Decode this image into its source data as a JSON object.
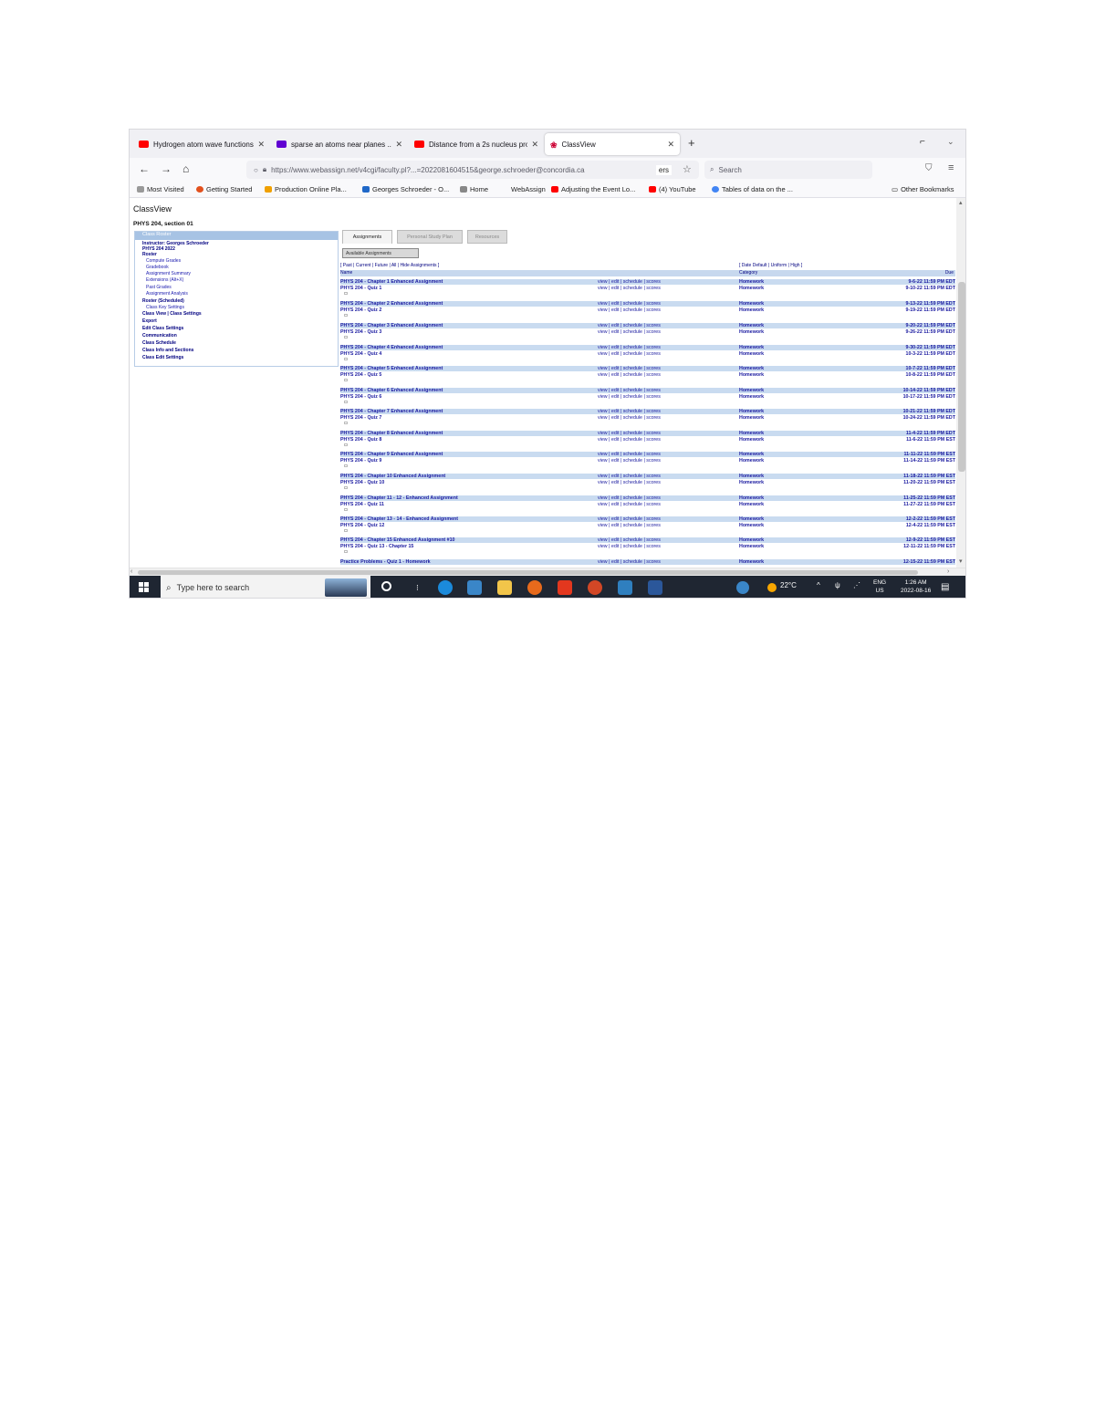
{
  "browser": {
    "tabs": [
      {
        "title": "Hydrogen atom wave functions",
        "favicon": "youtube"
      },
      {
        "title": "sparse an atoms near planes ... ",
        "favicon": "yahoo"
      },
      {
        "title": "Distance from a 2s nucleus pro",
        "favicon": "youtube"
      },
      {
        "title": "ClassView",
        "favicon": "classview"
      }
    ],
    "new_tab": "+",
    "url": "https://www.webassign.net/v4cgi/faculty.pl?...=2022081604515&george.schroeder@concordia.ca",
    "url_suffix": "ers",
    "search_placeholder": "Search",
    "bookmarks": [
      "Most Visited",
      "Getting Started",
      "Production Online Pla...",
      "Georges Schroeder - O...",
      "Home",
      "WebAssign",
      "Adjusting the Event Lo...",
      "(4) YouTube",
      "Tables of data on the ..."
    ],
    "other_bookmarks": "Other Bookmarks"
  },
  "page": {
    "title": "ClassView",
    "course": "PHYS 204, section 01",
    "left_nav": {
      "header": "Class Roster",
      "items": [
        "Instructor: Georges Schroeder",
        "PHYS 204 2022",
        "Roster",
        "Compute Grades",
        "Gradebook",
        "Assignment Summary",
        "Extensions (Alt+X)",
        "Past Grades",
        "Assignment Analysis",
        "Roster (Scheduled)",
        "Class Key Settings",
        "Class View | Class Settings",
        "Export",
        "Edit Class Settings",
        "Communication",
        "Class Schedule",
        "Class Info and Sections",
        "Class Edit Settings"
      ]
    },
    "tabs": [
      "Assignments",
      "Personal Study Plan",
      "Resources"
    ],
    "available_button": "Available Assignments",
    "filter_links": "[ Past | Current | Future | All | Hide Assignments ]",
    "filter_links_right": "[ Date Default | Uniform | High ]",
    "columns": {
      "name": "Name",
      "category": "Category",
      "due": "Due"
    },
    "assignments": [
      {
        "name": "PHYS 204 - Chapter 1 Enhanced Assignment",
        "links": "view | edit | schedule | scores",
        "category": "Homework",
        "due": "9-6-22 11:59 PM EDT"
      },
      {
        "name": "PHYS 204 - Quiz 1",
        "links": "view | edit | schedule | scores",
        "category": "Homework",
        "due": "9-10-22 11:59 PM EDT"
      },
      {
        "name": "PHYS 204 - Chapter 2 Enhanced Assignment",
        "links": "view | edit | schedule | scores",
        "category": "Homework",
        "due": "9-13-22 11:59 PM EDT"
      },
      {
        "name": "PHYS 204 - Quiz 2",
        "links": "view | edit | schedule | scores",
        "category": "Homework",
        "due": "9-19-22 11:59 PM EDT"
      },
      {
        "name": "PHYS 204 - Chapter 3 Enhanced Assignment",
        "links": "view | edit | schedule | scores",
        "category": "Homework",
        "due": "9-20-22 11:59 PM EDT"
      },
      {
        "name": "PHYS 204 - Quiz 3",
        "links": "view | edit | schedule | scores",
        "category": "Homework",
        "due": "9-26-22 11:59 PM EDT"
      },
      {
        "name": "PHYS 204 - Chapter 4 Enhanced Assignment",
        "links": "view | edit | schedule | scores",
        "category": "Homework",
        "due": "9-30-22 11:59 PM EDT"
      },
      {
        "name": "PHYS 204 - Quiz 4",
        "links": "view | edit | schedule | scores",
        "category": "Homework",
        "due": "10-3-22 11:59 PM EDT"
      },
      {
        "name": "PHYS 204 - Chapter 5 Enhanced Assignment",
        "links": "view | edit | schedule | scores",
        "category": "Homework",
        "due": "10-7-22 11:59 PM EDT"
      },
      {
        "name": "PHYS 204 - Quiz 5",
        "links": "view | edit | schedule | scores",
        "category": "Homework",
        "due": "10-8-22 11:59 PM EDT"
      },
      {
        "name": "PHYS 204 - Chapter 6 Enhanced Assignment",
        "links": "view | edit | schedule | scores",
        "category": "Homework",
        "due": "10-14-22 11:59 PM EDT"
      },
      {
        "name": "PHYS 204 - Quiz 6",
        "links": "view | edit | schedule | scores",
        "category": "Homework",
        "due": "10-17-22 11:59 PM EDT"
      },
      {
        "name": "PHYS 204 - Chapter 7 Enhanced Assignment",
        "links": "view | edit | schedule | scores",
        "category": "Homework",
        "due": "10-21-22 11:59 PM EDT"
      },
      {
        "name": "PHYS 204 - Quiz 7",
        "links": "view | edit | schedule | scores",
        "category": "Homework",
        "due": "10-24-22 11:59 PM EDT"
      },
      {
        "name": "PHYS 204 - Chapter 8 Enhanced Assignment",
        "links": "view | edit | schedule | scores",
        "category": "Homework",
        "due": "11-4-22 11:59 PM EDT"
      },
      {
        "name": "PHYS 204 - Quiz 8",
        "links": "view | edit | schedule | scores",
        "category": "Homework",
        "due": "11-6-22 11:59 PM EST"
      },
      {
        "name": "PHYS 204 - Chapter 9 Enhanced Assignment",
        "links": "view | edit | schedule | scores",
        "category": "Homework",
        "due": "11-11-22 11:59 PM EST"
      },
      {
        "name": "PHYS 204 - Quiz 9",
        "links": "view | edit | schedule | scores",
        "category": "Homework",
        "due": "11-14-22 11:59 PM EST"
      },
      {
        "name": "PHYS 204 - Chapter 10 Enhanced Assignment",
        "links": "view | edit | schedule | scores",
        "category": "Homework",
        "due": "11-18-22 11:59 PM EST"
      },
      {
        "name": "PHYS 204 - Quiz 10",
        "links": "view | edit | schedule | scores",
        "category": "Homework",
        "due": "11-20-22 11:59 PM EST"
      },
      {
        "name": "PHYS 204 - Chapter 11 - 12 - Enhanced Assignment",
        "links": "view | edit | schedule | scores",
        "category": "Homework",
        "due": "11-25-22 11:59 PM EST"
      },
      {
        "name": "PHYS 204 - Quiz 11",
        "links": "view | edit | schedule | scores",
        "category": "Homework",
        "due": "11-27-22 11:59 PM EST"
      },
      {
        "name": "PHYS 204 - Chapter 13 - 14 - Enhanced Assignment",
        "links": "view | edit | schedule | scores",
        "category": "Homework",
        "due": "12-2-22 11:59 PM EST"
      },
      {
        "name": "PHYS 204 - Quiz 12",
        "links": "view | edit | schedule | scores",
        "category": "Homework",
        "due": "12-4-22 11:59 PM EST"
      },
      {
        "name": "PHYS 204 - Chapter 15 Enhanced Assignment #10",
        "links": "view | edit | schedule | scores",
        "category": "Homework",
        "due": "12-9-22 11:59 PM EST"
      },
      {
        "name": "PHYS 204 - Quiz 13 - Chapter 15",
        "links": "view | edit | schedule | scores",
        "category": "Homework",
        "due": "12-11-22 11:59 PM EST"
      },
      {
        "name": "Practice Problems - Quiz 1 - Homework",
        "links": "view | edit | schedule | scores",
        "category": "Homework",
        "due": "12-15-22 11:59 PM EST"
      }
    ]
  },
  "taskbar": {
    "search_placeholder": "Type here to search",
    "weather": "22°C",
    "lang": "ENG",
    "region": "US",
    "time": "1:26 AM",
    "date": "2022-08-16"
  },
  "colors": {
    "row_highlight": "#c9dbf0",
    "link_blue": "#1a1aa0",
    "taskbar": "#1f2632",
    "nav_header": "#a7c3e4"
  }
}
